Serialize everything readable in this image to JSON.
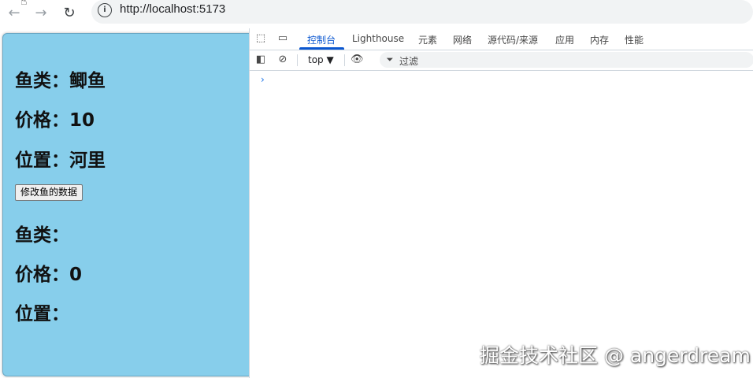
{
  "browser": {
    "url": "http://localhost:5173",
    "back_icon": "arrow-left-icon",
    "forward_icon": "arrow-right-icon",
    "reload_icon": "reload-icon",
    "info_icon": "info-icon"
  },
  "app": {
    "background": "#87ceeb",
    "first": {
      "kind": "鱼类：鲫鱼",
      "price": "价格：10",
      "location": "位置：河里"
    },
    "button_label": "修改鱼的数据",
    "second": {
      "kind": "鱼类：",
      "price": "价格：0",
      "location": "位置："
    }
  },
  "devtools": {
    "tabs": [
      "控制台",
      "Lighthouse",
      "元素",
      "网络",
      "源代码/来源",
      "应用",
      "内存",
      "性能"
    ],
    "active_tab": "控制台",
    "context": "top ▼",
    "filter_placeholder": "过滤",
    "prompt": "›",
    "accent": "#0b57d0"
  },
  "watermark": "掘金技术社区 @ angerdream"
}
